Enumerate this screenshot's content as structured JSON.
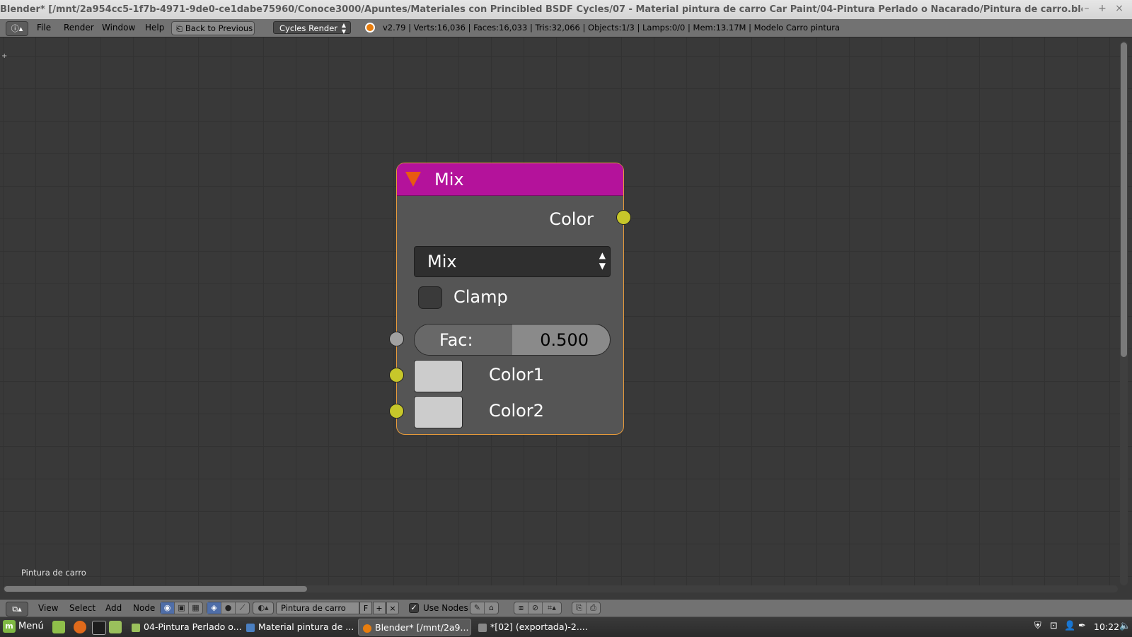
{
  "window": {
    "title": "Blender* [/mnt/2a954cc5-1f7b-4971-9de0-ce1dabe75960/Conoce3000/Apuntes/Materiales con Princibled BSDF Cycles/07 - Material pintura de carro Car Paint/04-Pintura Perlado o Nacarado/Pintura de carro.blend]",
    "controls": {
      "minimize": "–",
      "maximize": "+",
      "close": "×"
    }
  },
  "info_header": {
    "editor_icon": "info-icon",
    "menus": [
      "File",
      "Render",
      "Window",
      "Help"
    ],
    "back_button": "Back to Previous",
    "render_engine": "Cycles Render",
    "stats": "v2.79 | Verts:16,036 | Faces:16,033 | Tris:32,066 | Objects:1/3 | Lamps:0/0 | Mem:13.17M | Modelo Carro pintura"
  },
  "node_editor": {
    "material_label": "Pintura de carro",
    "node": {
      "title": "Mix",
      "header_color": "#b4129b",
      "output": {
        "label": "Color",
        "socket_color": "#c7c72a"
      },
      "blend_type": "Mix",
      "clamp": {
        "label": "Clamp",
        "checked": false
      },
      "fac": {
        "label": "Fac:",
        "value": "0.500",
        "fraction": 0.5
      },
      "inputs": [
        {
          "label": "Color1",
          "swatch": "#cccccc"
        },
        {
          "label": "Color2",
          "swatch": "#cccccc"
        }
      ]
    }
  },
  "node_header": {
    "menus": [
      "View",
      "Select",
      "Add",
      "Node"
    ],
    "material_name": "Pintura de carro",
    "fake_user": "F",
    "add_icon": "+",
    "remove_icon": "×",
    "use_nodes": {
      "label": "Use Nodes",
      "checked": true
    }
  },
  "taskbar": {
    "menu": "Menú",
    "tasks": [
      {
        "label": "04-Pintura Perlado o...",
        "active": false
      },
      {
        "label": "Material pintura de ...",
        "active": false
      },
      {
        "label": "Blender* [/mnt/2a9...",
        "active": true
      },
      {
        "label": "*[02] (exportada)-2....",
        "active": false
      }
    ],
    "clock": "10:22"
  }
}
